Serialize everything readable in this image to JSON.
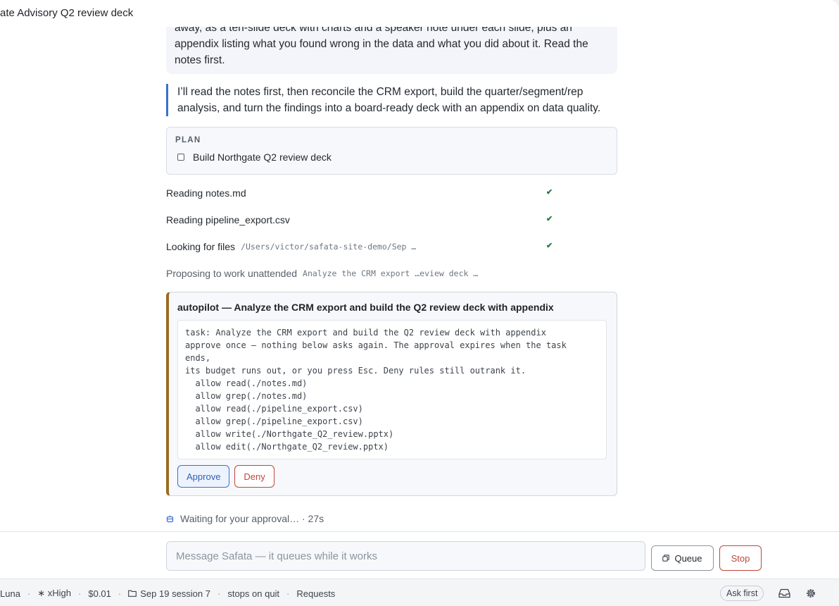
{
  "window": {
    "title": "ate Advisory Q2 review deck"
  },
  "user_message": {
    "line1": "away, as a ten-slide deck with charts and a speaker note under each slide, plus an",
    "line2": "appendix listing what you found wrong in the data and what you did about it. Read the",
    "line3": "notes first."
  },
  "assistant_message": {
    "line1": "I’ll read the notes first, then reconcile the CRM export, build the quarter/segment/rep",
    "line2": "analysis, and turn the findings into a board-ready deck with an appendix on data quality."
  },
  "plan": {
    "label": "PLAN",
    "items": [
      {
        "label": "Build Northgate Q2 review deck",
        "checked": false
      }
    ]
  },
  "steps": [
    {
      "label": "Reading notes.md",
      "detail": "",
      "status": "✔"
    },
    {
      "label": "Reading pipeline_export.csv",
      "detail": "",
      "status": "✔"
    },
    {
      "label": "Looking for files",
      "detail": "/Users/victor/safata-site-demo/Sep …",
      "status": "✔"
    },
    {
      "label": "Proposing to work unattended",
      "detail": "Analyze the CRM export …eview deck …",
      "status": ""
    }
  ],
  "autopilot": {
    "title": "autopilot — Analyze the CRM export and build the Q2 review deck with appendix",
    "code": "task: Analyze the CRM export and build the Q2 review deck with appendix\napprove once — nothing below asks again. The approval expires when the task\nends,\nits budget runs out, or you press Esc. Deny rules still outrank it.\n  allow read(./notes.md)\n  allow grep(./notes.md)\n  allow read(./pipeline_export.csv)\n  allow grep(./pipeline_export.csv)\n  allow write(./Northgate_Q2_review.pptx)\n  allow edit(./Northgate_Q2_review.pptx)",
    "approve_label": "Approve",
    "deny_label": "Deny",
    "accent_color": "#9a6b1e"
  },
  "waiting": {
    "text": "Waiting for your approval… · 27s",
    "icon": "robot-icon"
  },
  "composer": {
    "placeholder": "Message Safata — it queues while it works",
    "value": "",
    "queue_label": "Queue",
    "stop_label": "Stop"
  },
  "statusbar": {
    "model": "Luna",
    "effort": "∗ xHigh",
    "cost": "$0.01",
    "session": "Sep 19 session 7",
    "stop_policy": "stops on quit",
    "requests": "Requests",
    "permission_mode": "Ask first",
    "icons": [
      "folder-icon",
      "inbox-icon",
      "gear-icon"
    ]
  },
  "colors": {
    "accent_blue": "#3b6fd4",
    "danger_red": "#c0473b",
    "success_green": "#1a7f37"
  }
}
